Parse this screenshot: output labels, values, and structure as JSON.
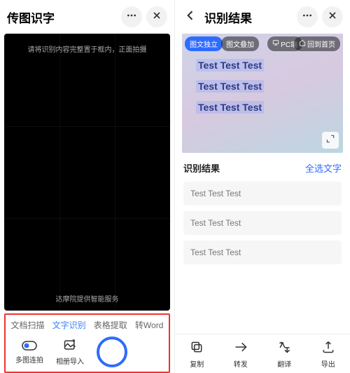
{
  "left": {
    "title": "传图识字",
    "cam_hint": "请将识别内容完整置于框内，正面拍摄",
    "cam_footer": "达摩院提供智能服务",
    "tabs": [
      "文档扫描",
      "文字识别",
      "表格提取",
      "转Word"
    ],
    "active_tab_index": 1,
    "tool_multishot": "多图连拍",
    "tool_import": "相册导入"
  },
  "right": {
    "title": "识别结果",
    "pill_mode1": "图文独立",
    "pill_mode2": "图文叠加",
    "pill_pc": "PC端",
    "pill_home": "回到首页",
    "preview_lines": [
      "Test Test Test",
      "Test Test Test",
      "Test Test Test"
    ],
    "result_label": "识别结果",
    "select_all": "全选文字",
    "results": [
      "Test Test Test",
      "Test Test Test",
      "Test Test Test"
    ],
    "actions": {
      "copy": "复制",
      "forward": "转发",
      "translate": "翻译",
      "export": "导出"
    }
  }
}
